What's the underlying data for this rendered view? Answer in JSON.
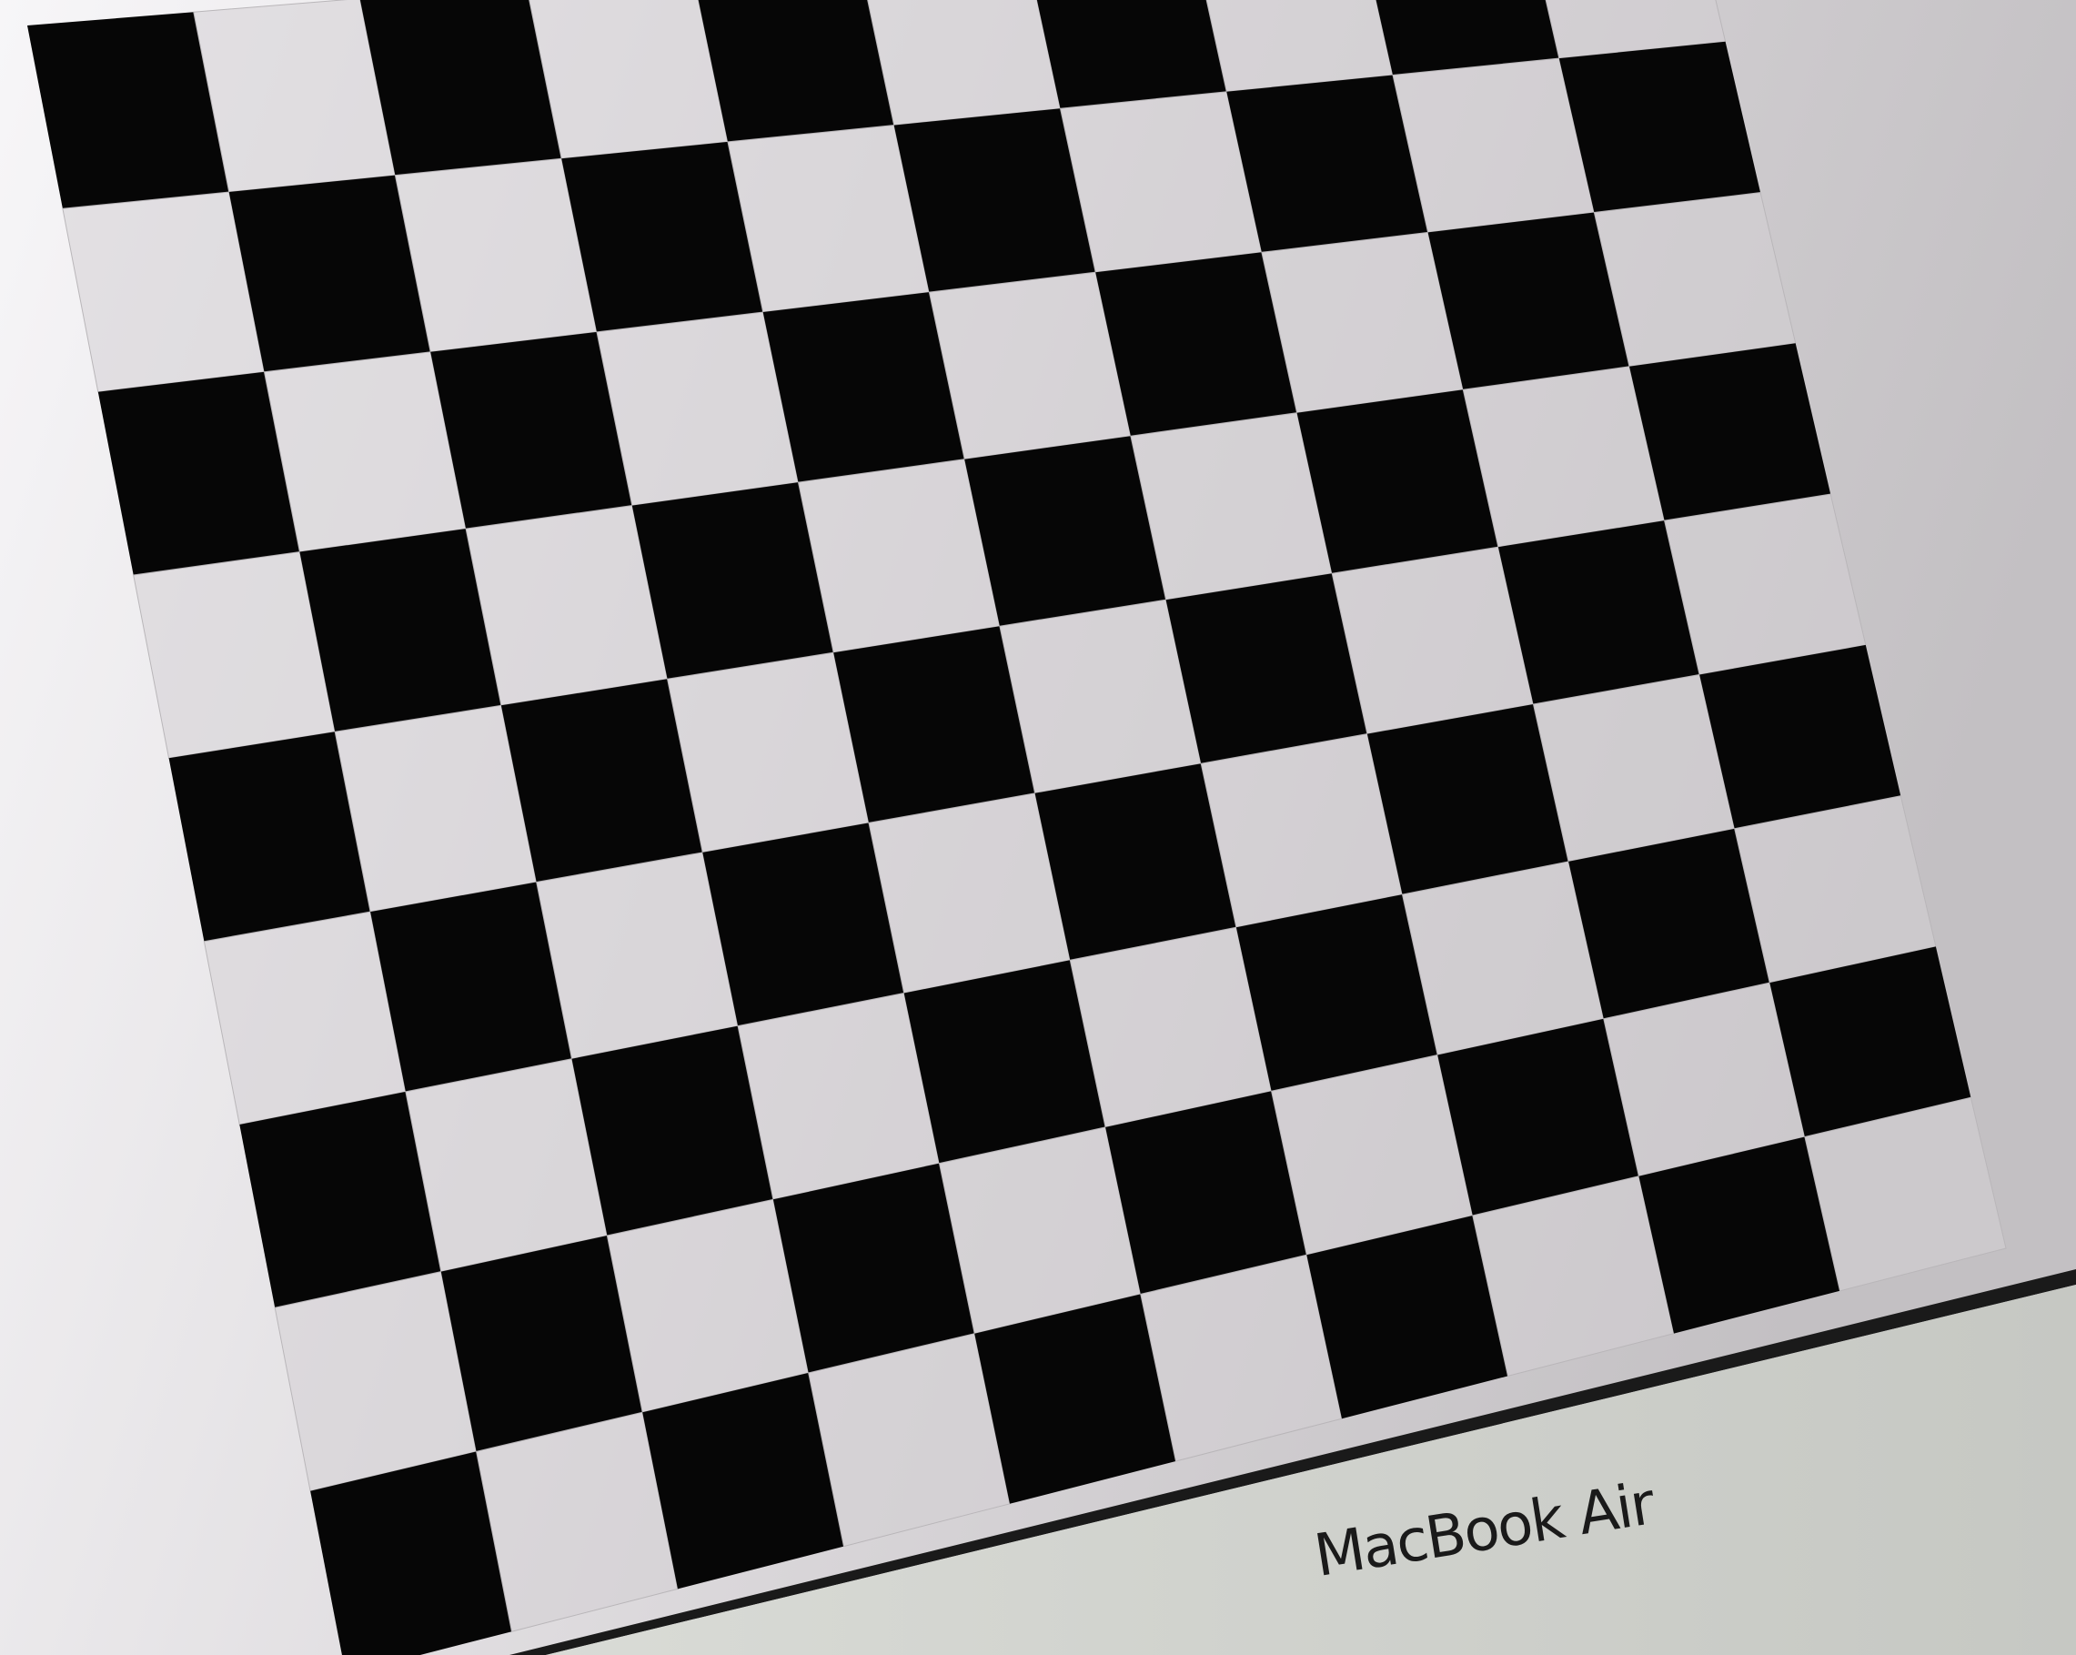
{
  "photo": {
    "subject": "checkerboard-on-laptop-screen",
    "board": {
      "rows": 9,
      "cols": 10
    },
    "colors": {
      "dark_square": "#060606",
      "light_square": "#d4d0d3",
      "screen_bright": "#f7f6f8",
      "screen_dim": "#c3c0c3",
      "bezel": "#cfd1cc",
      "screen_edge": "#1a1a1a",
      "brand_text": "#1a1a1a"
    }
  },
  "bezel": {
    "brand_label": "MacBook Air"
  }
}
